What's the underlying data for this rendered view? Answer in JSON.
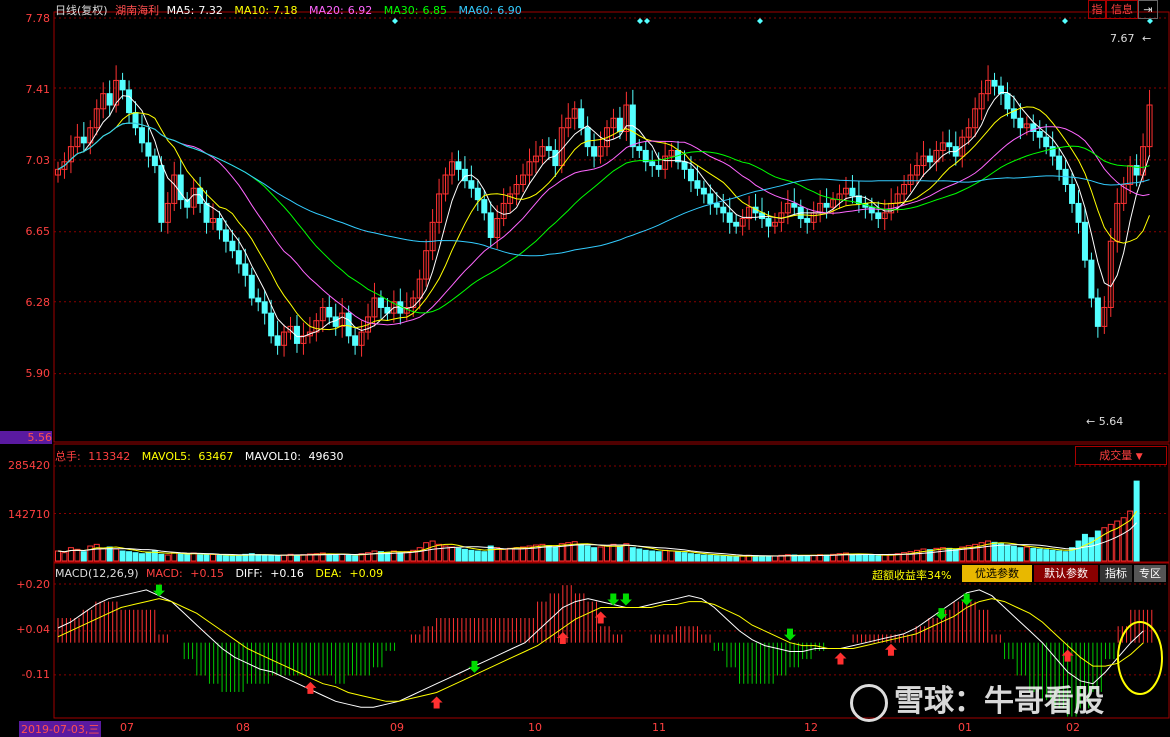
{
  "header": {
    "period": "日线(复权)",
    "stock": "湖南海利",
    "ma": [
      {
        "label": "MA5:",
        "value": "7.32",
        "color": "#ffffff"
      },
      {
        "label": "MA10:",
        "value": "7.18",
        "color": "#ffff00"
      },
      {
        "label": "MA20:",
        "value": "6.92",
        "color": "#ff66ff"
      },
      {
        "label": "MA30:",
        "value": "6.85",
        "color": "#00ff00"
      },
      {
        "label": "MA60:",
        "value": "6.90",
        "color": "#33ccff"
      }
    ],
    "btn_index": "指",
    "btn_info": "信息",
    "btn_exit_icon": "exit-icon"
  },
  "price_axis": {
    "ticks": [
      "7.78",
      "7.41",
      "7.03",
      "6.65",
      "6.28",
      "5.90",
      "5.56"
    ],
    "high_label": "7.67",
    "low_label": "5.64"
  },
  "volume": {
    "label_total": "总手:",
    "total": "113342",
    "mavol5_label": "MAVOL5:",
    "mavol5": "63467",
    "mavol10_label": "MAVOL10:",
    "mavol10": "49630",
    "ticks": [
      "285420",
      "142710"
    ],
    "selector": "成交量"
  },
  "macd": {
    "label": "MACD(12,26,9)",
    "macd_label": "MACD:",
    "macd": "+0.15",
    "diff_label": "DIFF:",
    "diff": "+0.16",
    "dea_label": "DEA:",
    "dea": "+0.09",
    "excess_return": "超额收益率34%",
    "btn_optimize": "优选参数",
    "btn_default": "默认参数",
    "btn_indicator": "指标",
    "btn_zone": "专区",
    "ticks": [
      "+0.20",
      "+0.04",
      "-0.11"
    ]
  },
  "date_axis": {
    "current": "2019-07-03,三",
    "months": [
      "07",
      "08",
      "09",
      "10",
      "11",
      "12",
      "01",
      "02"
    ]
  },
  "watermark": "雪球：牛哥看股",
  "colors": {
    "up": "#ff3232",
    "down": "#54ffff",
    "grid": "#8a0000",
    "ma5": "#ffffff",
    "ma10": "#ffff00",
    "ma20": "#ff66ff",
    "ma30": "#00ff00",
    "ma60": "#33ccff",
    "diff": "#ffffff",
    "dea": "#ffff00"
  },
  "chart_data": {
    "type": "candlestick",
    "title": "湖南海利 日线(复权)",
    "price_range": [
      5.56,
      7.78
    ],
    "volume_range": [
      0,
      285420
    ],
    "macd_range": [
      -0.25,
      0.2
    ],
    "close": [
      6.98,
      7.02,
      7.1,
      7.15,
      7.12,
      7.2,
      7.3,
      7.38,
      7.32,
      7.45,
      7.4,
      7.28,
      7.2,
      7.12,
      7.05,
      7.0,
      6.7,
      6.8,
      6.95,
      6.82,
      6.78,
      6.88,
      6.8,
      6.7,
      6.72,
      6.66,
      6.6,
      6.55,
      6.48,
      6.42,
      6.3,
      6.28,
      6.22,
      6.1,
      6.05,
      6.12,
      6.15,
      6.06,
      6.1,
      6.12,
      6.18,
      6.25,
      6.2,
      6.15,
      6.22,
      6.1,
      6.05,
      6.12,
      6.2,
      6.3,
      6.25,
      6.22,
      6.28,
      6.22,
      6.25,
      6.3,
      6.4,
      6.55,
      6.7,
      6.85,
      6.95,
      7.02,
      6.98,
      6.92,
      6.88,
      6.82,
      6.75,
      6.62,
      6.72,
      6.8,
      6.85,
      6.9,
      6.95,
      7.02,
      7.05,
      7.1,
      7.08,
      7.0,
      7.2,
      7.25,
      7.3,
      7.2,
      7.1,
      7.05,
      7.1,
      7.2,
      7.25,
      7.18,
      7.32,
      7.1,
      7.08,
      7.02,
      7.0,
      6.98,
      7.05,
      7.08,
      7.02,
      6.98,
      6.92,
      6.88,
      6.85,
      6.8,
      6.78,
      6.75,
      6.7,
      6.68,
      6.72,
      6.78,
      6.75,
      6.72,
      6.68,
      6.7,
      6.75,
      6.8,
      6.78,
      6.72,
      6.7,
      6.75,
      6.8,
      6.78,
      6.82,
      6.85,
      6.88,
      6.84,
      6.8,
      6.78,
      6.75,
      6.72,
      6.75,
      6.8,
      6.85,
      6.9,
      6.95,
      7.0,
      7.05,
      7.02,
      7.08,
      7.12,
      7.1,
      7.05,
      7.15,
      7.2,
      7.3,
      7.38,
      7.45,
      7.42,
      7.38,
      7.3,
      7.25,
      7.2,
      7.22,
      7.18,
      7.15,
      7.1,
      7.05,
      6.98,
      6.9,
      6.8,
      6.7,
      6.5,
      6.3,
      6.15,
      6.25,
      6.6,
      6.8,
      6.9,
      7.0,
      6.95,
      7.1,
      7.32
    ],
    "volume": [
      30000,
      25000,
      40000,
      35000,
      28000,
      45000,
      50000,
      38000,
      42000,
      36000,
      30000,
      28000,
      25000,
      22000,
      27000,
      30000,
      20000,
      18000,
      25000,
      22000,
      20000,
      24000,
      19000,
      18000,
      20000,
      17000,
      16000,
      15000,
      18000,
      20000,
      22000,
      19000,
      17000,
      16000,
      15000,
      18000,
      20000,
      17000,
      19000,
      21000,
      22000,
      24000,
      20000,
      18000,
      21000,
      17000,
      16000,
      22000,
      25000,
      30000,
      28000,
      26000,
      30000,
      25000,
      28000,
      32000,
      40000,
      55000,
      60000,
      50000,
      45000,
      42000,
      38000,
      35000,
      32000,
      30000,
      28000,
      45000,
      40000,
      35000,
      38000,
      40000,
      42000,
      45000,
      48000,
      50000,
      46000,
      42000,
      52000,
      55000,
      58000,
      50000,
      45000,
      40000,
      42000,
      46000,
      50000,
      44000,
      52000,
      40000,
      36000,
      32000,
      30000,
      28000,
      32000,
      30000,
      27000,
      25000,
      22000,
      20000,
      18000,
      17000,
      16000,
      15000,
      14000,
      13000,
      15000,
      17000,
      16000,
      15000,
      14000,
      15000,
      17000,
      19000,
      18000,
      16000,
      15000,
      17000,
      19000,
      18000,
      20000,
      22000,
      24000,
      21000,
      20000,
      18000,
      17000,
      16000,
      18000,
      20000,
      22000,
      25000,
      28000,
      32000,
      36000,
      34000,
      38000,
      40000,
      38000,
      35000,
      42000,
      46000,
      50000,
      55000,
      60000,
      56000,
      52000,
      48000,
      44000,
      40000,
      42000,
      38000,
      36000,
      34000,
      32000,
      30000,
      28000,
      40000,
      60000,
      80000,
      70000,
      90000,
      100000,
      110000,
      120000,
      130000,
      150000,
      240000
    ],
    "diff": [
      0.05,
      0.07,
      0.1,
      0.13,
      0.15,
      0.16,
      0.17,
      0.18,
      0.16,
      0.14,
      0.1,
      0.06,
      0.02,
      -0.02,
      -0.05,
      -0.07,
      -0.09,
      -0.1,
      -0.12,
      -0.14,
      -0.16,
      -0.18,
      -0.2,
      -0.21,
      -0.22,
      -0.22,
      -0.21,
      -0.2,
      -0.18,
      -0.16,
      -0.14,
      -0.12,
      -0.1,
      -0.08,
      -0.06,
      -0.04,
      -0.02,
      0.0,
      0.04,
      0.08,
      0.12,
      0.14,
      0.15,
      0.14,
      0.13,
      0.12,
      0.12,
      0.13,
      0.14,
      0.15,
      0.16,
      0.15,
      0.12,
      0.08,
      0.04,
      0.01,
      -0.01,
      -0.02,
      -0.03,
      -0.03,
      -0.02,
      -0.02,
      -0.02,
      -0.01,
      0.0,
      0.01,
      0.02,
      0.03,
      0.05,
      0.08,
      0.11,
      0.14,
      0.17,
      0.18,
      0.16,
      0.12,
      0.08,
      0.04,
      0.0,
      -0.05,
      -0.1,
      -0.13,
      -0.14,
      -0.1,
      -0.05,
      0.0,
      0.04
    ],
    "dea": [
      0.02,
      0.04,
      0.06,
      0.08,
      0.1,
      0.12,
      0.13,
      0.14,
      0.15,
      0.14,
      0.12,
      0.1,
      0.07,
      0.04,
      0.01,
      -0.02,
      -0.04,
      -0.06,
      -0.08,
      -0.1,
      -0.12,
      -0.14,
      -0.15,
      -0.17,
      -0.18,
      -0.19,
      -0.2,
      -0.2,
      -0.19,
      -0.18,
      -0.17,
      -0.15,
      -0.13,
      -0.11,
      -0.09,
      -0.07,
      -0.05,
      -0.03,
      -0.01,
      0.02,
      0.05,
      0.08,
      0.1,
      0.12,
      0.12,
      0.12,
      0.12,
      0.12,
      0.13,
      0.13,
      0.14,
      0.14,
      0.13,
      0.11,
      0.09,
      0.06,
      0.04,
      0.02,
      0.0,
      -0.01,
      -0.01,
      -0.02,
      -0.02,
      -0.02,
      -0.01,
      0.0,
      0.01,
      0.02,
      0.03,
      0.05,
      0.07,
      0.09,
      0.12,
      0.14,
      0.15,
      0.14,
      0.12,
      0.1,
      0.07,
      0.03,
      -0.01,
      -0.05,
      -0.08,
      -0.08,
      -0.07,
      -0.04,
      0.0
    ]
  }
}
